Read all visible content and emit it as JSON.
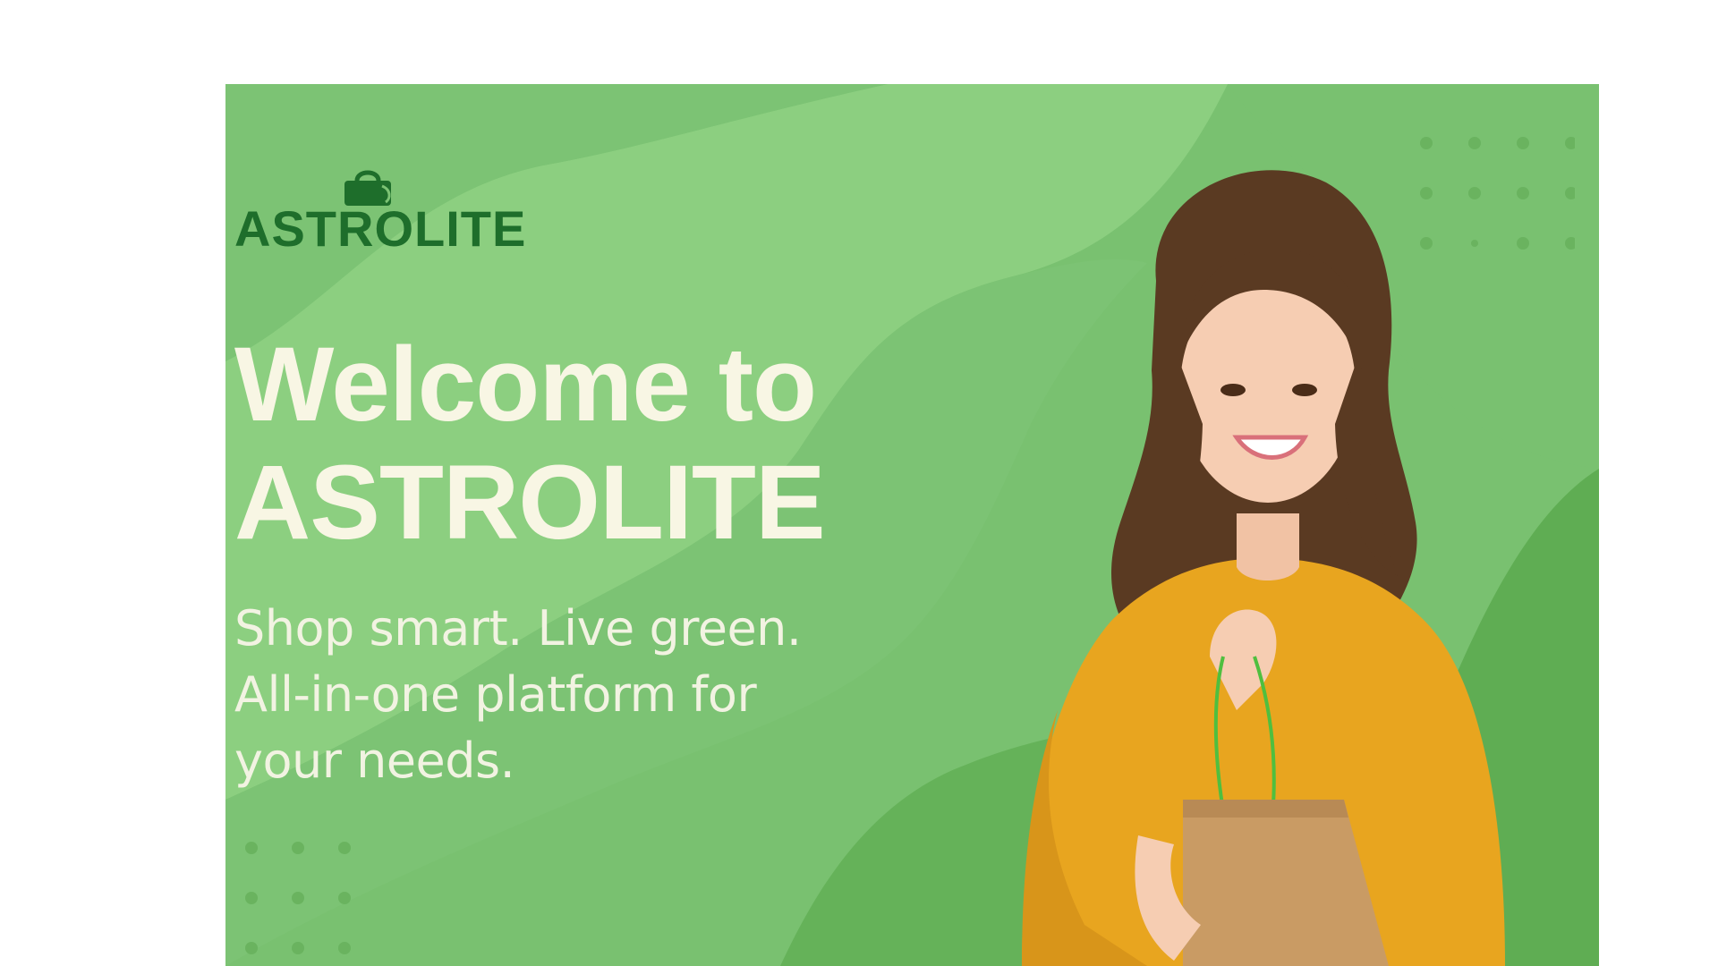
{
  "brand": {
    "name": "ASTROLITE",
    "logo_icon": "shopping-bag-icon"
  },
  "hero": {
    "headline_line1": "Welcome to",
    "headline_line2": "ASTROLITE",
    "tagline": "Shop smart. Live green. All-in-one platform for your needs."
  },
  "colors": {
    "banner_green": "#7cc374",
    "light_green": "#8ccf80",
    "dark_green": "#64b058",
    "brand_green": "#1e6e2b",
    "headline_cream": "#f8f6e4",
    "sweater_yellow": "#e8a51f",
    "bag_kraft": "#c99b64"
  }
}
